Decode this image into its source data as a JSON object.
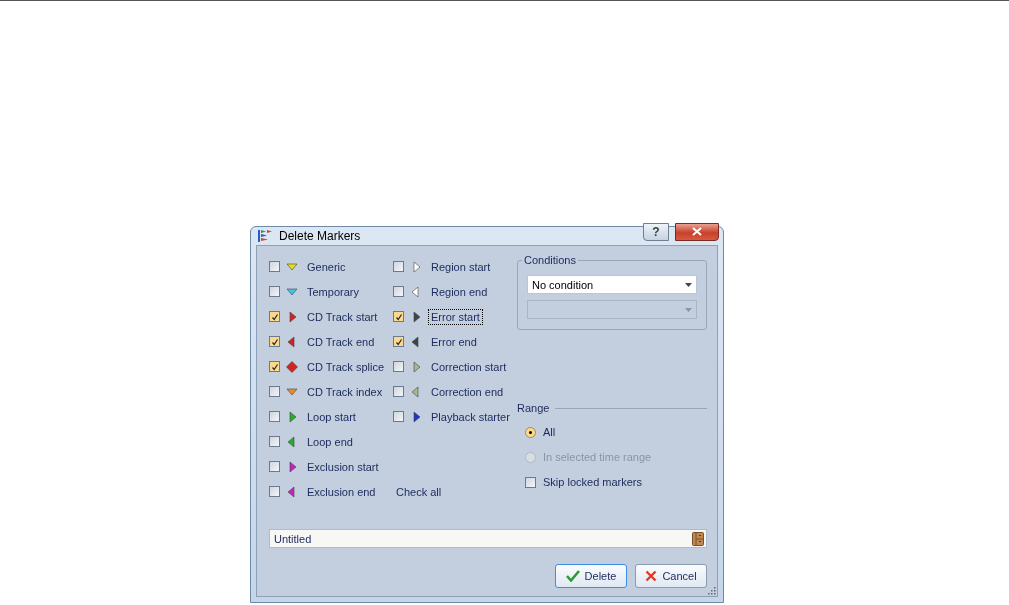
{
  "window": {
    "title": "Delete Markers",
    "help_button": "?"
  },
  "marker_columns": [
    {
      "items": [
        {
          "label": "Generic",
          "checked": false,
          "focused": false,
          "kind": "down",
          "color": "#e8dc1c"
        },
        {
          "label": "Temporary",
          "checked": false,
          "focused": false,
          "kind": "down",
          "color": "#3cc4ec"
        },
        {
          "label": "CD Track start",
          "checked": true,
          "focused": false,
          "kind": "right",
          "color": "#d42222"
        },
        {
          "label": "CD Track end",
          "checked": true,
          "focused": false,
          "kind": "left",
          "color": "#d42222"
        },
        {
          "label": "CD Track splice",
          "checked": true,
          "focused": false,
          "kind": "diamond",
          "color": "#d42222"
        },
        {
          "label": "CD Track index",
          "checked": false,
          "focused": false,
          "kind": "down",
          "color": "#f08a20"
        },
        {
          "label": "Loop start",
          "checked": false,
          "focused": false,
          "kind": "right",
          "color": "#22b02a"
        },
        {
          "label": "Loop end",
          "checked": false,
          "focused": false,
          "kind": "left",
          "color": "#22b02a"
        },
        {
          "label": "Exclusion start",
          "checked": false,
          "focused": false,
          "kind": "right",
          "color": "#c822c0"
        },
        {
          "label": "Exclusion end",
          "checked": false,
          "focused": false,
          "kind": "left",
          "color": "#c822c0"
        }
      ]
    },
    {
      "items": [
        {
          "label": "Region start",
          "checked": false,
          "focused": false,
          "kind": "right",
          "color": "#ffffff"
        },
        {
          "label": "Region end",
          "checked": false,
          "focused": false,
          "kind": "left",
          "color": "#ffffff"
        },
        {
          "label": "Error start",
          "checked": true,
          "focused": true,
          "kind": "right",
          "color": "#3c4648"
        },
        {
          "label": "Error end",
          "checked": true,
          "focused": false,
          "kind": "left",
          "color": "#3c4648"
        },
        {
          "label": "Correction start",
          "checked": false,
          "focused": false,
          "kind": "right",
          "color": "#a8b88c"
        },
        {
          "label": "Correction end",
          "checked": false,
          "focused": false,
          "kind": "left",
          "color": "#a8b88c"
        },
        {
          "label": "Playback starter",
          "checked": false,
          "focused": false,
          "kind": "right",
          "color": "#2234c8"
        }
      ]
    }
  ],
  "check_all": "Check all",
  "conditions": {
    "title": "Conditions",
    "condition": {
      "value": "No condition",
      "disabled": false
    },
    "second": {
      "disabled": true
    }
  },
  "range": {
    "title": "Range",
    "options": [
      {
        "label": "All",
        "selected": true,
        "disabled": false
      },
      {
        "label": "In selected time range",
        "selected": false,
        "disabled": true
      }
    ],
    "skip_locked": {
      "label": "Skip locked markers",
      "checked": false
    }
  },
  "name_field": {
    "value": "Untitled"
  },
  "buttons": [
    {
      "label": "Delete",
      "kind": "ok"
    },
    {
      "label": "Cancel",
      "kind": "cancel"
    }
  ]
}
